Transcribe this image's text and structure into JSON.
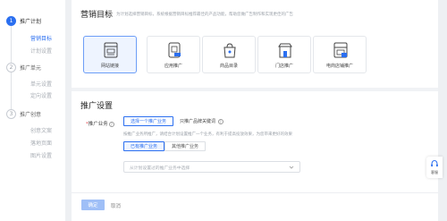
{
  "sidebar": {
    "steps": [
      {
        "num": "1",
        "label": "推广计划",
        "subs": [
          "营销目标",
          "计划设置"
        ]
      },
      {
        "num": "2",
        "label": "推广单元",
        "subs": [
          "单元设置",
          "定向设置"
        ]
      },
      {
        "num": "3",
        "label": "推广创意",
        "subs": [
          "创意文案",
          "落地页面",
          "图片设置"
        ]
      }
    ]
  },
  "marketing": {
    "title": "营销目标",
    "desc": "为计划选择营销目标，系统根据营销目标推荐最佳的产品功能，帮助您做广告制作和实现更佳的广告",
    "goals": [
      {
        "label": "网站链接",
        "icon": "website-link-icon"
      },
      {
        "label": "应用推广",
        "icon": "app-promotion-icon"
      },
      {
        "label": "商品目录",
        "icon": "product-catalog-icon"
      },
      {
        "label": "门店推广",
        "icon": "store-promotion-icon"
      },
      {
        "label": "电商店铺推广",
        "icon": "ecommerce-store-icon"
      }
    ]
  },
  "promo": {
    "title": "推广设置",
    "field_label": "推广业务",
    "help": "?",
    "select_button": "选择一个推广业务",
    "keyword_option": "只推广品牌关键词",
    "hint": "按推广业务所推广，请结合计划设置推广一个业务，有利于提高投放效果，为您带来更好的效果",
    "seg_existing": "已有推广业务",
    "seg_other": "其他推广业务",
    "dropdown_placeholder": "从计划设置过的推广业务中选择"
  },
  "footer": {
    "next": "确定",
    "cancel": "取消"
  },
  "helper": {
    "label": "客服"
  },
  "colors": {
    "accent": "#2b6ff0",
    "accent_soft": "#eef4ff",
    "disabled_button": "#9fbff7"
  }
}
